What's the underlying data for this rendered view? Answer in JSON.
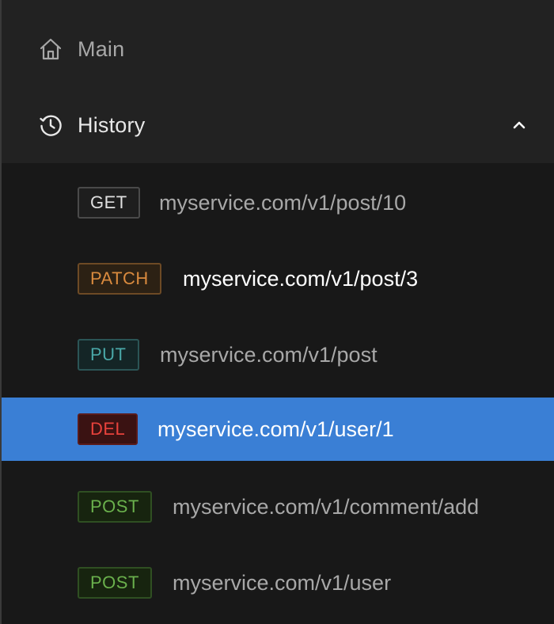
{
  "sidebar": {
    "main": {
      "label": "Main",
      "icon": "home-icon"
    },
    "history": {
      "label": "History",
      "icon": "history-icon",
      "expanded": true,
      "chevron": "chevron-up-icon"
    }
  },
  "history": {
    "items": [
      {
        "method": "GET",
        "url": "myservice.com/v1/post/10"
      },
      {
        "method": "PATCH",
        "url": "myservice.com/v1/post/3"
      },
      {
        "method": "PUT",
        "url": "myservice.com/v1/post"
      },
      {
        "method": "DEL",
        "url": "myservice.com/v1/user/1"
      },
      {
        "method": "POST",
        "url": "myservice.com/v1/comment/add"
      },
      {
        "method": "POST",
        "url": "myservice.com/v1/user"
      }
    ]
  },
  "colors": {
    "selected_bg": "#3a7fd5",
    "get": "#e0e0e0",
    "patch": "#d98a3e",
    "put": "#4aa8a8",
    "del": "#e8423c",
    "post": "#6ab04c"
  }
}
